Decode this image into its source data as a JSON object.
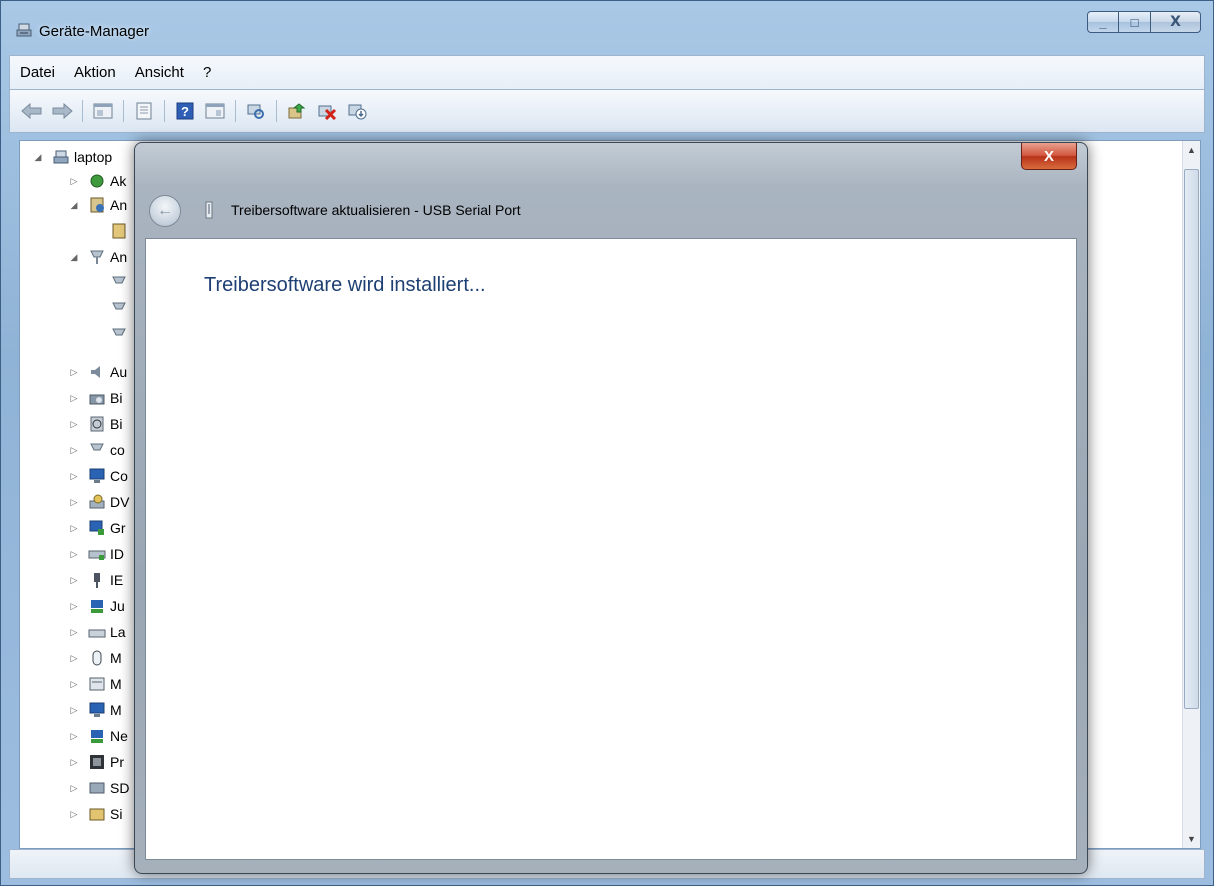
{
  "window": {
    "title": "Geräte-Manager",
    "minimize_label": "_",
    "maximize_label": "□",
    "close_label": "X"
  },
  "menu": [
    "Datei",
    "Aktion",
    "Ansicht",
    "?"
  ],
  "tree": {
    "root": "laptop",
    "items": [
      "Ak",
      "An",
      "",
      "An",
      "",
      "",
      "",
      "Au",
      "Bi",
      "Bi",
      "co",
      "Co",
      "DV",
      "Gr",
      "ID",
      "IE",
      "Ju",
      "La",
      "M",
      "M",
      "M",
      "Ne",
      "Pr",
      "SD",
      "Si"
    ]
  },
  "dialog": {
    "title": "Treibersoftware aktualisieren - USB Serial Port",
    "heading": "Treibersoftware wird installiert...",
    "close_label": "X"
  }
}
